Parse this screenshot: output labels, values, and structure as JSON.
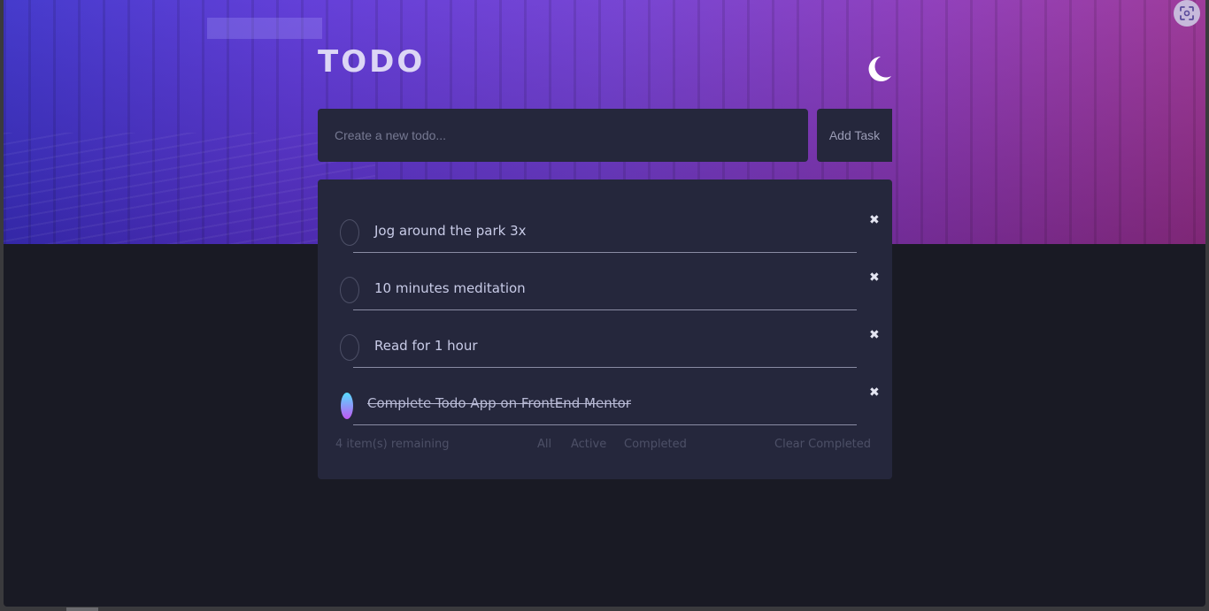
{
  "header": {
    "title": "TODO",
    "theme_toggle_icon": "moon-icon"
  },
  "new_todo": {
    "placeholder": "Create a new todo...",
    "value": "",
    "add_label": "Add Task"
  },
  "todos": [
    {
      "text": "Jog around the park 3x",
      "completed": false
    },
    {
      "text": "10 minutes meditation",
      "completed": false
    },
    {
      "text": "Read for 1 hour",
      "completed": false
    },
    {
      "text": "Complete Todo App on FrontEnd Mentor",
      "completed": true
    }
  ],
  "delete_icon": "close-icon",
  "footer": {
    "remaining": "4 item(s) remaining",
    "filters": [
      "All",
      "Active",
      "Completed"
    ],
    "clear_label": "Clear Completed"
  },
  "overlay": {
    "scan_icon": "screenshot-scan-icon"
  },
  "colors": {
    "background": "#191a24",
    "panel": "#25273c",
    "text": "#c8cbe7",
    "muted": "#4d5067",
    "check_gradient_start": "#57ddff",
    "check_gradient_end": "#c058f3",
    "hero_start": "#3a2fc9",
    "hero_end": "#9a2f8f"
  }
}
